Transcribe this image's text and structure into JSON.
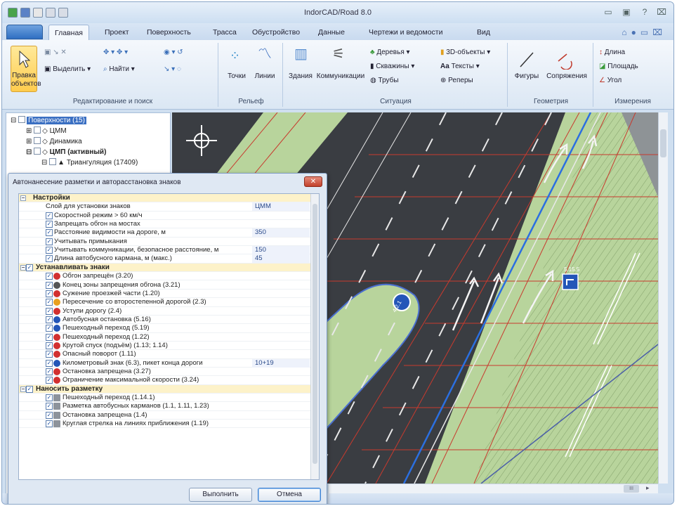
{
  "app": {
    "title": "IndorCAD/Road 8.0",
    "window_buttons": [
      "▭",
      "▣",
      "?",
      "⌧"
    ]
  },
  "tabs": [
    "Главная",
    "Проект",
    "Поверхность",
    "Трасса",
    "Обустройство",
    "Данные",
    "Чертежи и ведомости",
    "Вид"
  ],
  "ribbon": {
    "groups": [
      {
        "label": "Редактирование и поиск"
      },
      {
        "label": "Рельеф"
      },
      {
        "label": "Ситуация"
      },
      {
        "label": "Геометрия"
      },
      {
        "label": "Измерения"
      }
    ],
    "edit_objects": "Правка объектов",
    "select": "Выделить",
    "find": "Найти",
    "points": "Точки",
    "lines": "Линии",
    "buildings": "Здания",
    "communications": "Коммуникации",
    "trees": "Деревья",
    "wells": "Скважины",
    "pipes": "Трубы",
    "objects3d": "3D-объекты",
    "texts": "Тексты",
    "benchmarks": "Реперы",
    "figures": "Фигуры",
    "conjugations": "Сопряжения",
    "length": "Длина",
    "area": "Площадь",
    "angle": "Угол"
  },
  "tree": {
    "surfaces": "Поверхности (15)",
    "tsm": "ЦММ",
    "dynamics": "Динамика",
    "tsmp": "ЦМП (активный)",
    "triangulation": "Триангуляция (17409)"
  },
  "dialog": {
    "title": "Автонанесение разметки и авторасстановка знаков",
    "sections": {
      "settings": "Настройки",
      "signs": "Устанавливать знаки",
      "marking": "Наносить разметку"
    },
    "settings": [
      {
        "label": "Слой для установки знаков",
        "value": "ЦММ",
        "checked": false
      },
      {
        "label": "Скоростной режим > 60 км/ч",
        "value": "",
        "checked": true
      },
      {
        "label": "Запрещать обгон на мостах",
        "value": "",
        "checked": true
      },
      {
        "label": "Расстояние видимости на дороге, м",
        "value": "350",
        "checked": true
      },
      {
        "label": "Учитывать примыкания",
        "value": "",
        "checked": true
      },
      {
        "label": "Учитывать коммуникации, безопасное расстояние, м",
        "value": "150",
        "checked": true
      },
      {
        "label": "Длина автобусного кармана, м (макс.)",
        "value": "45",
        "checked": true
      }
    ],
    "signs": [
      {
        "label": "Обгон запрещён (3.20)",
        "value": "",
        "icon_color": "#d23030"
      },
      {
        "label": "Конец зоны запрещения обгона (3.21)",
        "value": "",
        "icon_color": "#555555"
      },
      {
        "label": "Сужение проезжей части (1.20)",
        "value": "",
        "icon_color": "#d23030"
      },
      {
        "label": "Пересечение со второстепенной дорогой (2.3)",
        "value": "",
        "icon_color": "#e8a020"
      },
      {
        "label": "Уступи дорогу (2.4)",
        "value": "",
        "icon_color": "#d23030"
      },
      {
        "label": "Автобусная остановка (5.16)",
        "value": "",
        "icon_color": "#2456b8"
      },
      {
        "label": "Пешеходный переход (5.19)",
        "value": "",
        "icon_color": "#2456b8"
      },
      {
        "label": "Пешеходный переход (1.22)",
        "value": "",
        "icon_color": "#d23030"
      },
      {
        "label": "Крутой спуск (подъём) (1.13; 1.14)",
        "value": "",
        "icon_color": "#d23030"
      },
      {
        "label": "Опасный поворот (1.11)",
        "value": "",
        "icon_color": "#d23030"
      },
      {
        "label": "Километровый знак (6.3), пикет конца дороги",
        "value": "10+19",
        "icon_color": "#2456b8"
      },
      {
        "label": "Остановка запрещена (3.27)",
        "value": "",
        "icon_color": "#d23030"
      },
      {
        "label": "Ограничение максимальной скорости (3.24)",
        "value": "",
        "icon_color": "#d23030"
      }
    ],
    "marking": [
      {
        "label": "Пешеходный переход (1.14.1)"
      },
      {
        "label": "Разметка автобусных карманов (1.1, 1.11, 1.23)"
      },
      {
        "label": "Остановка запрещена (1.4)"
      },
      {
        "label": "Круглая стрелка на линиях приближения (1.19)"
      }
    ],
    "run_button": "Выполнить",
    "cancel_button": "Отмена"
  },
  "map": {
    "sign_labels": [
      "4.2.1",
      "5.15.5"
    ]
  },
  "scroll": {
    "thumb": "III",
    "arrow": "▸"
  },
  "colors": {
    "accent": "#2f6fc2",
    "selected": "#ffcc4d",
    "road": "#3c3f44",
    "grass": "#b7d39a",
    "red_lines": "#c83a2e",
    "blue_line": "#2b6fe0"
  }
}
